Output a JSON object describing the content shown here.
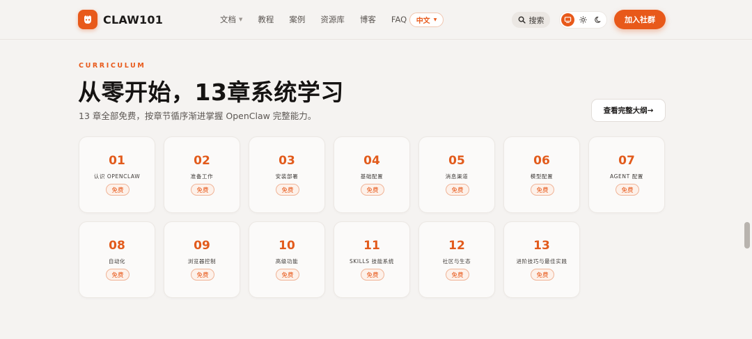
{
  "header": {
    "logo_text": "CLAW101",
    "nav": [
      {
        "label": "文档",
        "has_caret": true
      },
      {
        "label": "教程"
      },
      {
        "label": "案例"
      },
      {
        "label": "资源库"
      },
      {
        "label": "博客"
      },
      {
        "label": "FAQ"
      }
    ],
    "lang_label": "中文",
    "search_label": "搜索",
    "join_label": "加入社群",
    "accent_color": "#e8591a"
  },
  "hero": {
    "eyebrow": "CURRICULUM",
    "title": "从零开始，13章系统学习",
    "subtitle": "13 章全部免费，按章节循序渐进掌握 OpenClaw 完整能力。",
    "outline_button": "查看完整大纲→"
  },
  "chapters": [
    {
      "num": "01",
      "label": "认识 OPENCLAW",
      "badge": "免费"
    },
    {
      "num": "02",
      "label": "准备工作",
      "badge": "免费"
    },
    {
      "num": "03",
      "label": "安装部署",
      "badge": "免费"
    },
    {
      "num": "04",
      "label": "基础配置",
      "badge": "免费"
    },
    {
      "num": "05",
      "label": "消息渠道",
      "badge": "免费"
    },
    {
      "num": "06",
      "label": "模型配置",
      "badge": "免费"
    },
    {
      "num": "07",
      "label": "AGENT 配置",
      "badge": "免费"
    },
    {
      "num": "08",
      "label": "自动化",
      "badge": "免费"
    },
    {
      "num": "09",
      "label": "浏览器控制",
      "badge": "免费"
    },
    {
      "num": "10",
      "label": "高级功能",
      "badge": "免费"
    },
    {
      "num": "11",
      "label": "SKILLS 技能系统",
      "badge": "免费"
    },
    {
      "num": "12",
      "label": "社区与生态",
      "badge": "免费"
    },
    {
      "num": "13",
      "label": "进阶技巧与最佳实践",
      "badge": "免费"
    }
  ]
}
